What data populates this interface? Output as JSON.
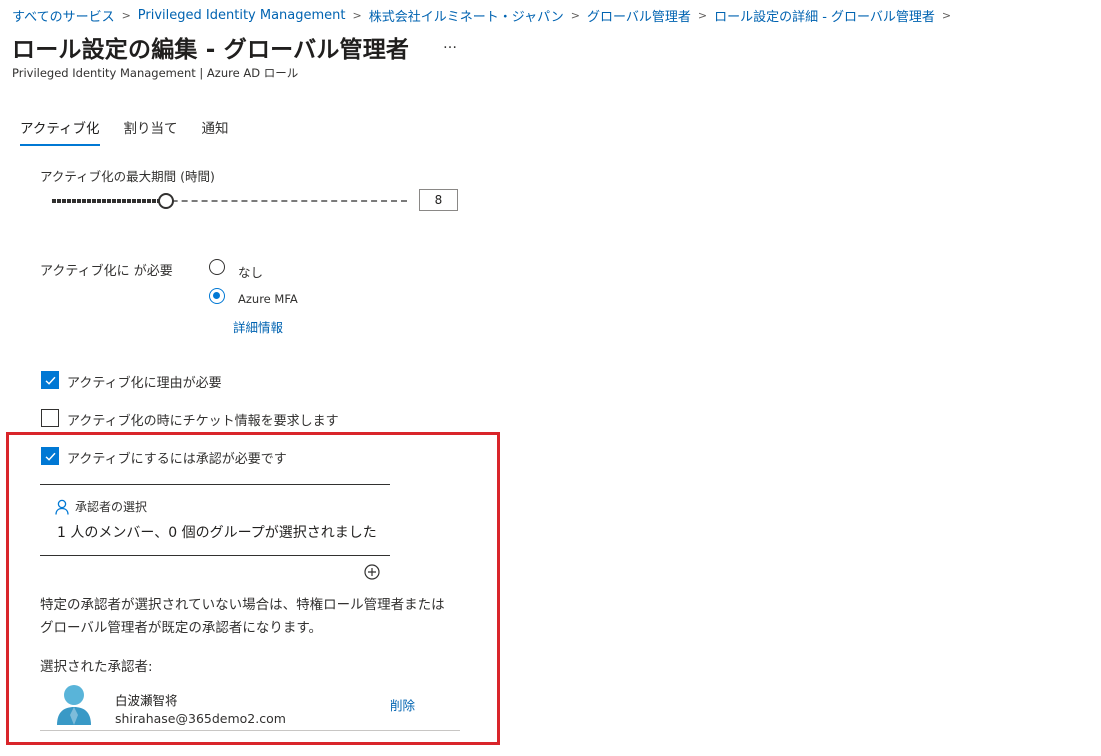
{
  "breadcrumb": [
    {
      "label": "すべてのサービス"
    },
    {
      "label": "Privileged Identity Management"
    },
    {
      "label": "株式会社イルミネート・ジャパン"
    },
    {
      "label": "グローバル管理者"
    },
    {
      "label": "ロール設定の詳細 - グローバル管理者"
    }
  ],
  "header": {
    "title": "ロール設定の編集 - グローバル管理者",
    "more": "…",
    "subtitle": "Privileged Identity Management | Azure AD ロール"
  },
  "tabs": [
    {
      "label": "アクティブ化",
      "active": true
    },
    {
      "label": "割り当て",
      "active": false
    },
    {
      "label": "通知",
      "active": false
    }
  ],
  "activation": {
    "max_duration_label": "アクティブ化の最大期間 (時間)",
    "max_duration_value": "8",
    "max_duration_slider_fraction": 0.32,
    "require_label": "アクティブ化に が必要",
    "options": [
      {
        "label": "なし",
        "checked": false
      },
      {
        "label": "Azure MFA",
        "checked": true
      }
    ],
    "more_info": "詳細情報",
    "checkboxes": [
      {
        "label": "アクティブ化に理由が必要",
        "checked": true
      },
      {
        "label": "アクティブ化の時にチケット情報を要求します",
        "checked": false
      },
      {
        "label": "アクティブにするには承認が必要です",
        "checked": true
      }
    ]
  },
  "approvers": {
    "select_label": "承認者の選択",
    "summary": "1 人のメンバー、0 個のグループが選択されました",
    "note_line1": "特定の承認者が選択されていない場合は、特権ロール管理者または",
    "note_line2": "グローバル管理者が既定の承認者になります。",
    "selected_label": "選択された承認者:",
    "selected": [
      {
        "name": "白波瀬智将",
        "email": "shirahase@365demo2.com",
        "remove": "削除"
      }
    ]
  },
  "colors": {
    "accent": "#0078d4",
    "link": "#0063b1",
    "highlight": "#d9252a"
  }
}
